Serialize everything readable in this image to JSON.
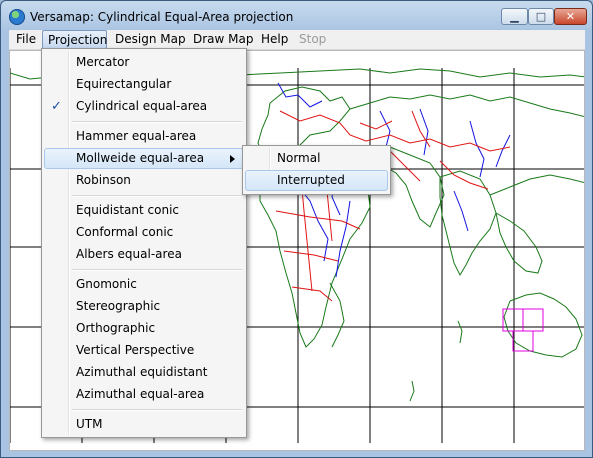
{
  "window": {
    "title": "Versamap: Cylindrical Equal-Area projection",
    "icon": "globe-icon",
    "controls": {
      "minimize_icon": "minimize-icon",
      "maximize_icon": "maximize-icon",
      "close_icon": "close-icon"
    }
  },
  "menubar": {
    "items": [
      {
        "label": "File"
      },
      {
        "label": "Projection",
        "active": true
      },
      {
        "label": "Design Map"
      },
      {
        "label": "Draw Map"
      },
      {
        "label": "Help"
      },
      {
        "label": "Stop",
        "disabled": true
      }
    ]
  },
  "projection_menu": {
    "items": [
      {
        "label": "Mercator"
      },
      {
        "label": "Equirectangular"
      },
      {
        "label": "Cylindrical equal-area",
        "checked": true
      },
      {
        "label": "Hammer equal-area"
      },
      {
        "label": "Mollweide equal-area",
        "has_submenu": true,
        "highlighted": true
      },
      {
        "label": "Robinson"
      },
      {
        "label": "Equidistant conic"
      },
      {
        "label": "Conformal conic"
      },
      {
        "label": "Albers equal-area"
      },
      {
        "label": "Gnomonic"
      },
      {
        "label": "Stereographic"
      },
      {
        "label": "Orthographic"
      },
      {
        "label": "Vertical Perspective"
      },
      {
        "label": "Azimuthal equidistant"
      },
      {
        "label": "Azimuthal equal-area"
      },
      {
        "label": "UTM"
      }
    ]
  },
  "mollweide_submenu": {
    "items": [
      {
        "label": "Normal"
      },
      {
        "label": "Interrupted",
        "highlighted": true
      }
    ]
  },
  "map": {
    "colors": {
      "coastline": "#1a7a1a",
      "rivers": "#1414e0",
      "borders": "#e01414",
      "grid": "#000000",
      "highlight": "#e000e0"
    }
  }
}
